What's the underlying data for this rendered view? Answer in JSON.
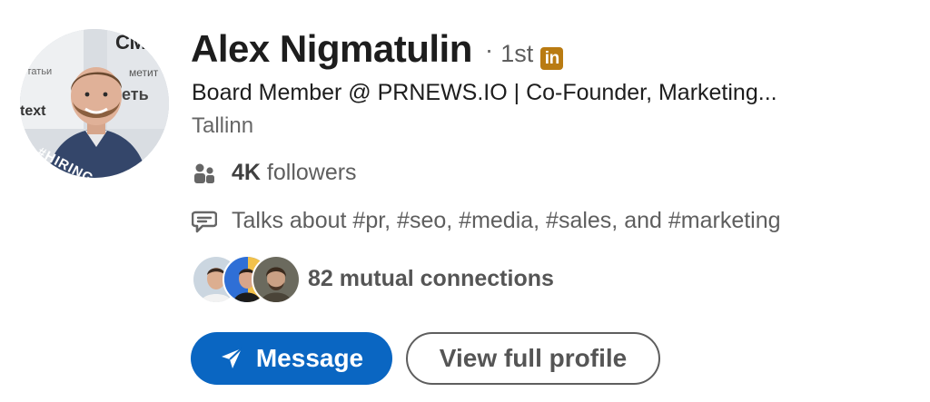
{
  "profile": {
    "name": "Alex Nigmatulin",
    "separator": "·",
    "degree": "1st",
    "badge": "in",
    "headline": "Board Member @ PRNEWS.IO | Co-Founder, Marketing...",
    "location": "Tallinn",
    "avatar_banner": "#HIRING"
  },
  "stats": {
    "followers_count": "4K",
    "followers_label": " followers",
    "talks_about": "Talks about #pr, #seo, #media, #sales, and #marketing",
    "mutual_connections": "82 mutual connections"
  },
  "actions": {
    "message_label": "Message",
    "view_profile_label": "View full profile"
  },
  "colors": {
    "primary": "#0a66c2",
    "hiring_banner": "#7b3fd6",
    "premium_badge": "#b97b12",
    "muted_text": "#666666"
  },
  "icons": {
    "followers": "people-icon",
    "talks": "speech-bubble-icon",
    "message": "send-icon"
  }
}
